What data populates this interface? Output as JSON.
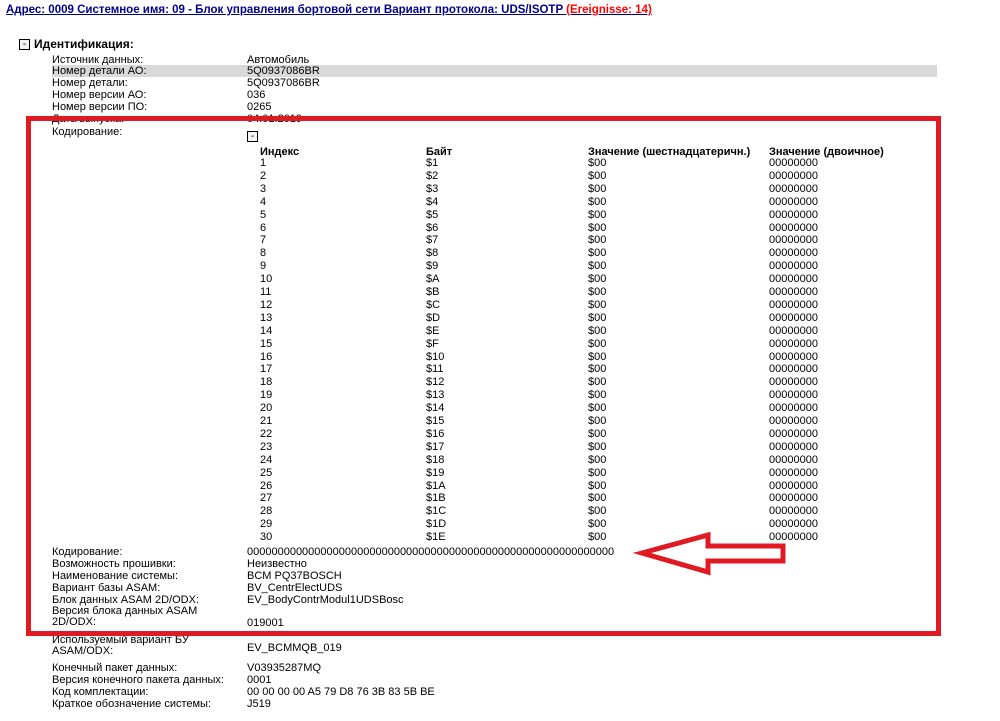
{
  "header": {
    "title": "Адрес: 0009 Системное имя: 09 - Блок управления бортовой сети Вариант протокола: UDS/ISOTP",
    "events": "(Ereignisse: 14)"
  },
  "section": {
    "toggle": "-",
    "title": "Идентификация:"
  },
  "top_fields": [
    {
      "label": "Источник данных:",
      "value": "Автомобиль"
    },
    {
      "label": "Номер детали АО:",
      "value": "5Q0937086BR"
    },
    {
      "label": "Номер детали:",
      "value": "5Q0937086BR"
    },
    {
      "label": "Номер версии АО:",
      "value": "036"
    },
    {
      "label": "Номер версии ПО:",
      "value": "0265"
    },
    {
      "label": "Дата выпуска:",
      "value": "04.01.2019"
    },
    {
      "label": "Кодирование:",
      "value": ""
    }
  ],
  "coding_toggle": "-",
  "table": {
    "headers": [
      "Индекс",
      "Байт",
      "Значение (шестнадцатеричн.)",
      "Значение (двоичное)"
    ],
    "rows": [
      [
        "1",
        "$1",
        "$00",
        "00000000"
      ],
      [
        "2",
        "$2",
        "$00",
        "00000000"
      ],
      [
        "3",
        "$3",
        "$00",
        "00000000"
      ],
      [
        "4",
        "$4",
        "$00",
        "00000000"
      ],
      [
        "5",
        "$5",
        "$00",
        "00000000"
      ],
      [
        "6",
        "$6",
        "$00",
        "00000000"
      ],
      [
        "7",
        "$7",
        "$00",
        "00000000"
      ],
      [
        "8",
        "$8",
        "$00",
        "00000000"
      ],
      [
        "9",
        "$9",
        "$00",
        "00000000"
      ],
      [
        "10",
        "$A",
        "$00",
        "00000000"
      ],
      [
        "11",
        "$B",
        "$00",
        "00000000"
      ],
      [
        "12",
        "$C",
        "$00",
        "00000000"
      ],
      [
        "13",
        "$D",
        "$00",
        "00000000"
      ],
      [
        "14",
        "$E",
        "$00",
        "00000000"
      ],
      [
        "15",
        "$F",
        "$00",
        "00000000"
      ],
      [
        "16",
        "$10",
        "$00",
        "00000000"
      ],
      [
        "17",
        "$11",
        "$00",
        "00000000"
      ],
      [
        "18",
        "$12",
        "$00",
        "00000000"
      ],
      [
        "19",
        "$13",
        "$00",
        "00000000"
      ],
      [
        "20",
        "$14",
        "$00",
        "00000000"
      ],
      [
        "21",
        "$15",
        "$00",
        "00000000"
      ],
      [
        "22",
        "$16",
        "$00",
        "00000000"
      ],
      [
        "23",
        "$17",
        "$00",
        "00000000"
      ],
      [
        "24",
        "$18",
        "$00",
        "00000000"
      ],
      [
        "25",
        "$19",
        "$00",
        "00000000"
      ],
      [
        "26",
        "$1A",
        "$00",
        "00000000"
      ],
      [
        "27",
        "$1B",
        "$00",
        "00000000"
      ],
      [
        "28",
        "$1C",
        "$00",
        "00000000"
      ],
      [
        "29",
        "$1D",
        "$00",
        "00000000"
      ],
      [
        "30",
        "$1E",
        "$00",
        "00000000"
      ]
    ]
  },
  "bottom_fields": [
    {
      "label": "Кодирование:",
      "value": "000000000000000000000000000000000000000000000000000000000000"
    },
    {
      "label": "Возможность прошивки:",
      "value": "Неизвестно"
    },
    {
      "label": "Наименование системы:",
      "value": "BCM PQ37BOSCH"
    },
    {
      "label": "Вариант базы ASAM:",
      "value": "BV_CentrElectUDS"
    },
    {
      "label": "Блок данных ASAM 2D/ODX:",
      "value": "EV_BodyContrModul1UDSBosc"
    },
    {
      "label": "Версия блока данных ASAM 2D/ODX:",
      "value": "019001"
    },
    {
      "label": "Используемый вариант БУ ASAM/ODX:",
      "value": "EV_BCMMQB_019"
    },
    {
      "label": "Конечный пакет данных:",
      "value": "V03935287MQ"
    },
    {
      "label": "Версия конечного пакета данных:",
      "value": "0001"
    },
    {
      "label": "Код комплектации:",
      "value": "00 00 00 00 A5 79 D8 76 3B 83 5B BE"
    },
    {
      "label": "Краткое обозначение системы:",
      "value": "J519"
    }
  ],
  "annotation": {
    "frame_color": "#e01a22"
  }
}
